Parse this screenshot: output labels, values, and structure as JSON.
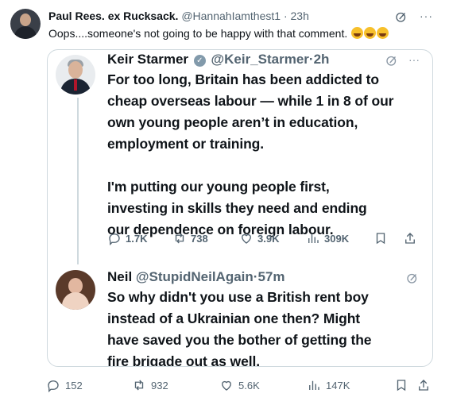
{
  "post": {
    "author_name": "Paul Rees. ex Rucksack.",
    "handle": "@HannahIamthest1",
    "separator": "·",
    "time": "23h",
    "text": "Oops....someone's not going to be happy with that comment.",
    "emoji": "🤣🤣🤣",
    "actions": {
      "replies": "152",
      "reposts": "932",
      "likes": "5.6K",
      "views": "147K"
    }
  },
  "quoted": [
    {
      "author_name": "Keir Starmer",
      "handle": "@Keir_Starmer",
      "separator": "·",
      "time": "2h",
      "verified": true,
      "body": "For too long, Britain has been addicted to\ncheap overseas labour — while 1 in 8 of our\nown young people aren’t in education,\nemployment or training.\n\nI'm putting our young people first,\ninvesting in skills they need and ending\nour dependence on foreign labour.",
      "actions": {
        "replies": "1.7K",
        "reposts": "738",
        "likes": "3.9K",
        "views": "309K"
      }
    },
    {
      "author_name": "Neil",
      "handle": "@StupidNeilAgain",
      "separator": "·",
      "time": "57m",
      "body": "So why didn't you use a British rent boy\ninstead of a Ukrainian one then? Might\nhave saved you the bother of getting the\nfire brigade out as well."
    }
  ],
  "icons": {
    "grok": "grok-icon",
    "more": "more-icon",
    "reply": "reply-icon",
    "repost": "repost-icon",
    "like": "heart-icon",
    "views": "views-icon",
    "bookmark": "bookmark-icon",
    "share": "share-icon",
    "verified": "verified-badge-icon"
  },
  "colors": {
    "text": "#0f1419",
    "secondary": "#536471",
    "border": "#cfd9de"
  }
}
